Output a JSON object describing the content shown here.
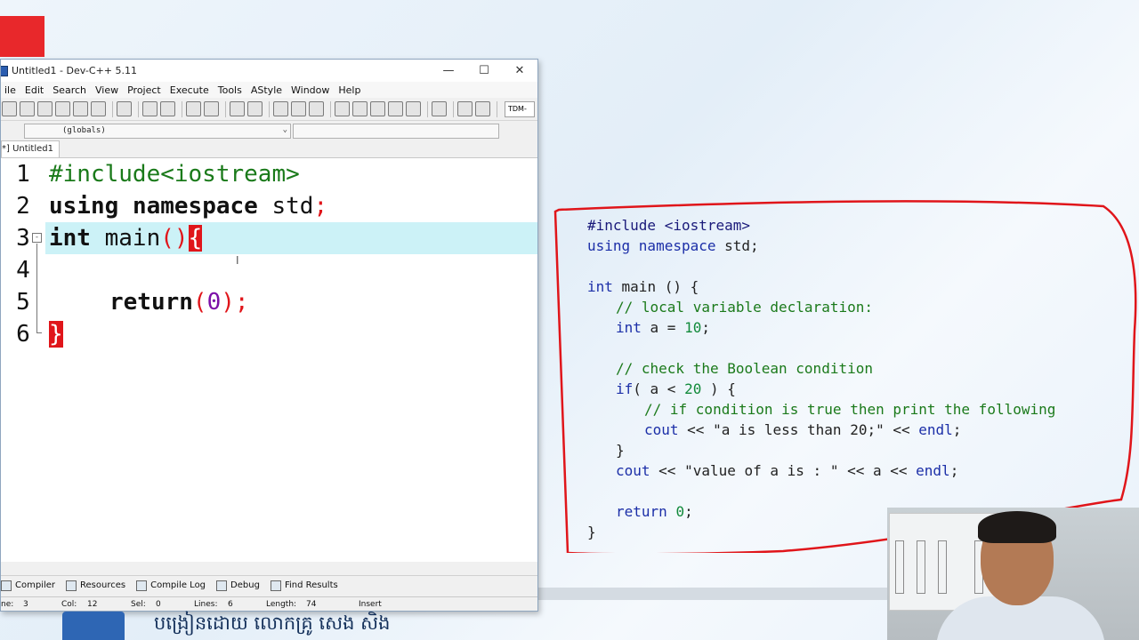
{
  "window": {
    "title": "Untitled1 - Dev-C++ 5.11",
    "controls": {
      "minimize": "—",
      "maximize": "☐",
      "close": "✕"
    }
  },
  "menu": [
    "ile",
    "Edit",
    "Search",
    "View",
    "Project",
    "Execute",
    "Tools",
    "AStyle",
    "Window",
    "Help"
  ],
  "toolbar": {
    "compiler": "TDM-"
  },
  "scope_selector": "(globals)",
  "tab": "*] Untitled1",
  "editor": {
    "line_numbers": [
      "1",
      "2",
      "3",
      "4",
      "5",
      "6"
    ],
    "line1": "#include<iostream>",
    "line2_kw1": "using",
    "line2_kw2": "namespace",
    "line2_rest": " std",
    "line2_semi": ";",
    "line3_kw": "int",
    "line3_name": " main",
    "line3_paren": "()",
    "line3_brace": "{",
    "line5_kw": "return",
    "line5_open": "(",
    "line5_num": "0",
    "line5_close": ");",
    "line6_brace": "}"
  },
  "bottom_tabs": [
    "Compiler",
    "Resources",
    "Compile Log",
    "Debug",
    "Find Results"
  ],
  "status": {
    "line_label": "ne:",
    "line_val": "3",
    "col_label": "Col:",
    "col_val": "12",
    "sel_label": "Sel:",
    "sel_val": "0",
    "lines_label": "Lines:",
    "lines_val": "6",
    "length_label": "Length:",
    "length_val": "74",
    "mode": "Insert"
  },
  "panel": {
    "l1": "#include <iostream>",
    "l2a": "using ",
    "l2b": "namespace",
    "l2c": " std;",
    "l3a": "int",
    "l3b": " main () {",
    "l4": "// local variable declaration:",
    "l5a": "int",
    "l5b": " a = ",
    "l5c": "10",
    "l5d": ";",
    "l6": "// check the Boolean condition",
    "l7a": "if",
    "l7b": "( a < ",
    "l7c": "20",
    "l7d": " ) {",
    "l8": "// if condition is true then print the following",
    "l9a": "cout",
    "l9b": " << ",
    "l9c": "\"a is less than 20;\"",
    "l9d": " << ",
    "l9e": "endl",
    "l9f": ";",
    "l10": "}",
    "l11a": "cout",
    "l11b": " << ",
    "l11c": "\"value of a is : \"",
    "l11d": " << a << ",
    "l11e": "endl",
    "l11f": ";",
    "l12a": "return",
    "l12b": " ",
    "l12c": "0",
    "l12d": ";",
    "l13": "}"
  },
  "footer_text": "បង្រៀនដោយ លោកគ្រូ សេង សិង",
  "colors": {
    "highlight_line": "#ccf2f7",
    "brace_match": "#e0151a",
    "annotation_red": "#e0151a",
    "comment_green": "#1b7a1b"
  }
}
